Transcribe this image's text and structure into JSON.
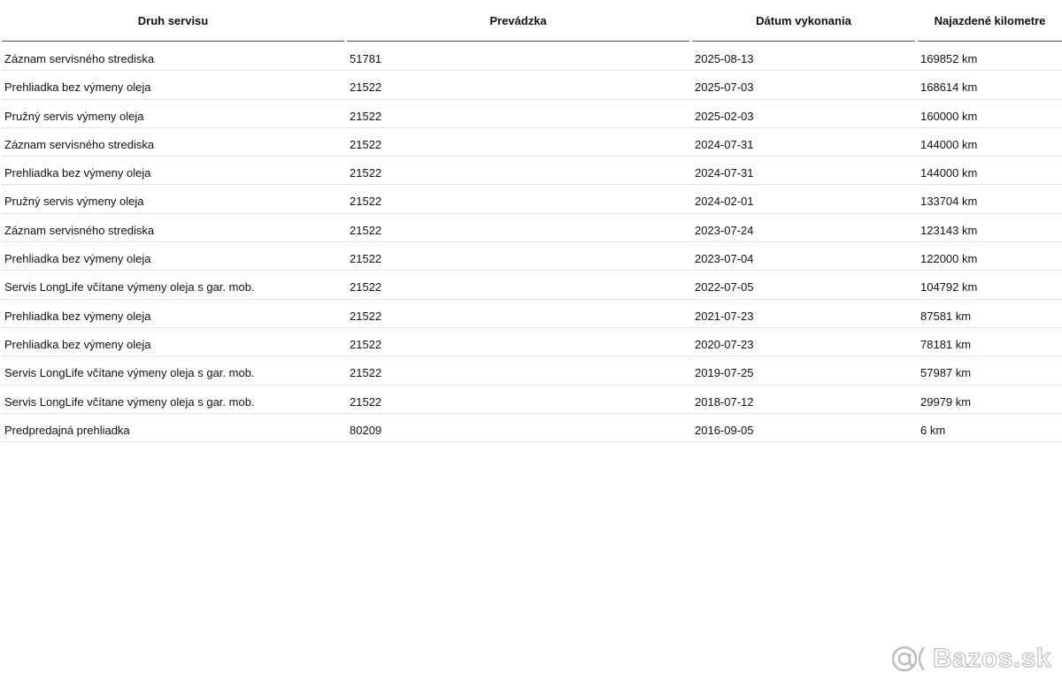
{
  "table": {
    "headers": [
      "Druh servisu",
      "Prevádzka",
      "Dátum vykonania",
      "Najazdené kilometre"
    ],
    "rows": [
      [
        "Záznam servisného strediska",
        "51781",
        "2025-08-13",
        "169852 km"
      ],
      [
        "Prehliadka bez výmeny oleja",
        "21522",
        "2025-07-03",
        "168614 km"
      ],
      [
        "Pružný servis výmeny oleja",
        "21522",
        "2025-02-03",
        "160000 km"
      ],
      [
        "Záznam servisného strediska",
        "21522",
        "2024-07-31",
        "144000 km"
      ],
      [
        "Prehliadka bez výmeny oleja",
        "21522",
        "2024-07-31",
        "144000 km"
      ],
      [
        "Pružný servis výmeny oleja",
        "21522",
        "2024-02-01",
        "133704 km"
      ],
      [
        "Záznam servisného strediska",
        "21522",
        "2023-07-24",
        "123143 km"
      ],
      [
        "Prehliadka bez výmeny oleja",
        "21522",
        "2023-07-04",
        "122000 km"
      ],
      [
        "Servis LongLife včítane výmeny oleja s gar. mob.",
        "21522",
        "2022-07-05",
        "104792 km"
      ],
      [
        "Prehliadka bez výmeny oleja",
        "21522",
        "2021-07-23",
        "87581 km"
      ],
      [
        "Prehliadka bez výmeny oleja",
        "21522",
        "2020-07-23",
        "78181 km"
      ],
      [
        "Servis LongLife včítane výmeny oleja s gar. mob.",
        "21522",
        "2019-07-25",
        "57987 km"
      ],
      [
        "Servis LongLife včítane výmeny oleja s gar. mob.",
        "21522",
        "2018-07-12",
        "29979 km"
      ],
      [
        "Predpredajná prehliadka",
        "80209",
        "2016-09-05",
        "6 km"
      ]
    ]
  },
  "watermark": {
    "text": "Bazos.sk",
    "icon": "at-sign-logo-icon"
  }
}
